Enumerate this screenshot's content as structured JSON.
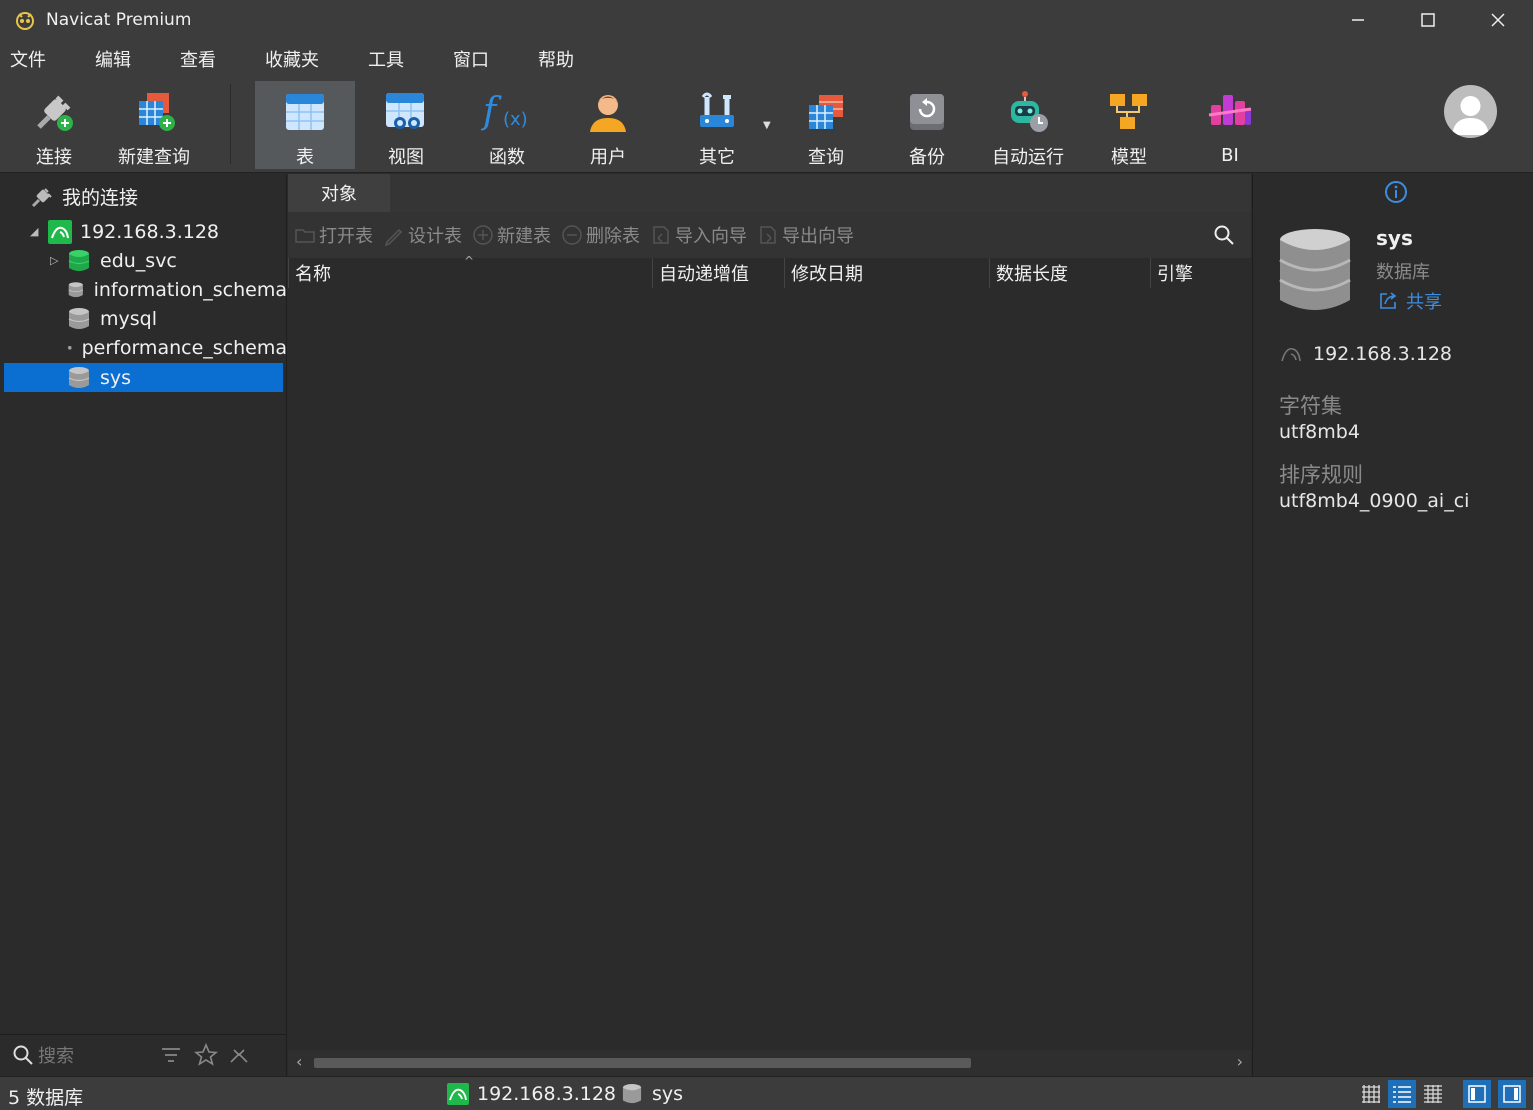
{
  "window": {
    "title": "Navicat Premium"
  },
  "menu": [
    "文件",
    "编辑",
    "查看",
    "收藏夹",
    "工具",
    "窗口",
    "帮助"
  ],
  "toolbar": {
    "connect": "连接",
    "new_query": "新建查询",
    "table": "表",
    "view": "视图",
    "function": "函数",
    "user": "用户",
    "other": "其它",
    "query": "查询",
    "backup": "备份",
    "automation": "自动运行",
    "model": "模型",
    "bi": "BI"
  },
  "sidebar": {
    "root": "我的连接",
    "connection": "192.168.3.128",
    "databases": [
      "edu_svc",
      "information_schema",
      "mysql",
      "performance_schema",
      "sys"
    ],
    "selected": "sys",
    "search_placeholder": "搜索"
  },
  "main": {
    "tab": "对象",
    "actions": {
      "open_table": "打开表",
      "design_table": "设计表",
      "new_table": "新建表",
      "delete_table": "删除表",
      "import_wizard": "导入向导",
      "export_wizard": "导出向导"
    },
    "columns": [
      "名称",
      "自动递增值",
      "修改日期",
      "数据长度",
      "引擎"
    ]
  },
  "info": {
    "name": "sys",
    "type": "数据库",
    "share": "共享",
    "connection": "192.168.3.128",
    "charset_label": "字符集",
    "charset": "utf8mb4",
    "collation_label": "排序规则",
    "collation": "utf8mb4_0900_ai_ci"
  },
  "status": {
    "db_count": "5 数据库",
    "connection": "192.168.3.128",
    "database": "sys"
  },
  "colors": {
    "accent": "#0a6fd1",
    "link": "#3b8ee0",
    "mysql_green": "#1fb84a"
  }
}
